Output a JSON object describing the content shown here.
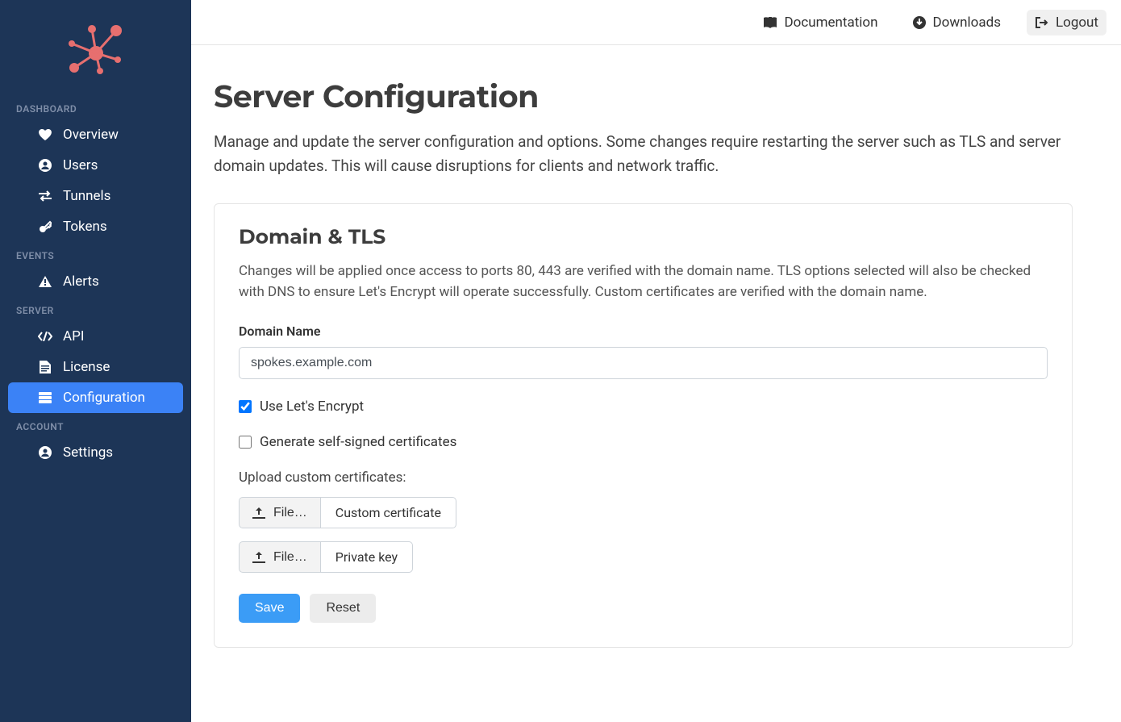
{
  "sidebar": {
    "sections": [
      {
        "heading": "DASHBOARD",
        "items": [
          {
            "label": "Overview",
            "icon": "heartbeat"
          },
          {
            "label": "Users",
            "icon": "user-circle"
          },
          {
            "label": "Tunnels",
            "icon": "transfer"
          },
          {
            "label": "Tokens",
            "icon": "key"
          }
        ]
      },
      {
        "heading": "EVENTS",
        "items": [
          {
            "label": "Alerts",
            "icon": "warning"
          }
        ]
      },
      {
        "heading": "SERVER",
        "items": [
          {
            "label": "API",
            "icon": "code"
          },
          {
            "label": "License",
            "icon": "file"
          },
          {
            "label": "Configuration",
            "icon": "server",
            "active": true
          }
        ]
      },
      {
        "heading": "ACCOUNT",
        "items": [
          {
            "label": "Settings",
            "icon": "user-circle"
          }
        ]
      }
    ]
  },
  "topbar": {
    "documentation": "Documentation",
    "downloads": "Downloads",
    "logout": "Logout"
  },
  "page": {
    "title": "Server Configuration",
    "description": "Manage and update the server configuration and options. Some changes require restarting the server such as TLS and server domain updates. This will cause disruptions for clients and network traffic."
  },
  "card": {
    "title": "Domain & TLS",
    "description": "Changes will be applied once access to ports 80, 443 are verified with the domain name. TLS options selected will also be checked with DNS to ensure Let's Encrypt will operate successfully. Custom certificates are verified with the domain name.",
    "domain_label": "Domain Name",
    "domain_value": "spokes.example.com",
    "lets_encrypt_label": "Use Let's Encrypt",
    "lets_encrypt_checked": true,
    "self_signed_label": "Generate self-signed certificates",
    "self_signed_checked": false,
    "upload_label": "Upload custom certificates:",
    "file_button": "File…",
    "cert_label": "Custom certificate",
    "key_label": "Private key",
    "save": "Save",
    "reset": "Reset"
  }
}
